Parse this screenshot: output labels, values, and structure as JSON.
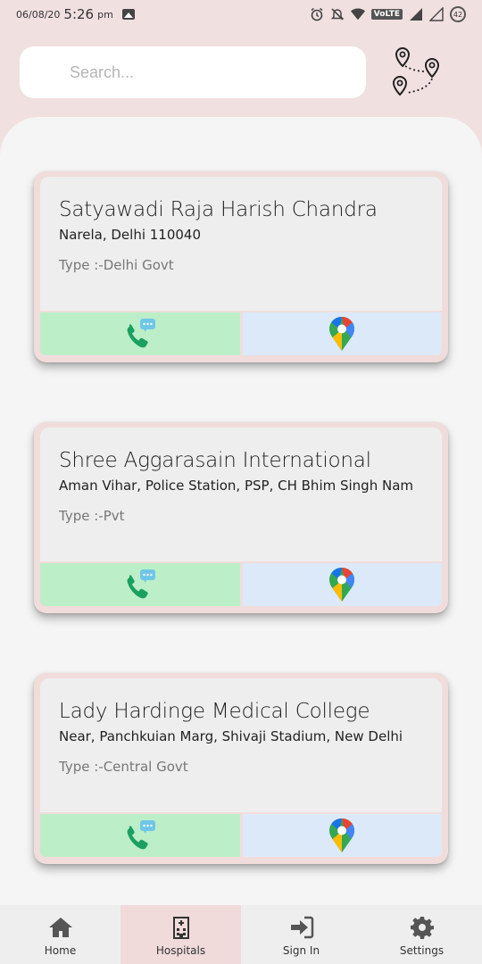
{
  "status_bar": {
    "date": "06/08/20",
    "time": "5:26",
    "ampm": "pm",
    "volte": "VoLTE",
    "battery": "42"
  },
  "search": {
    "placeholder": "Search..."
  },
  "hospitals": [
    {
      "name": "Satyawadi Raja Harish Chandra",
      "address": "Narela, Delhi 110040",
      "type": "Type :-Delhi Govt"
    },
    {
      "name": "Shree Aggarasain International",
      "address": "Aman Vihar, Police Station, PSP, CH Bhim Singh Nam",
      "type": "Type :-Pvt"
    },
    {
      "name": "Lady Hardinge Medical College",
      "address": "Near, Panchkuian Marg, Shivaji Stadium, New Delhi",
      "type": "Type :-Central Govt"
    }
  ],
  "nav": {
    "home": "Home",
    "hospitals": "Hospitals",
    "sign_in": "Sign In",
    "settings": "Settings",
    "active": "hospitals"
  },
  "colors": {
    "background": "#f1e0e0",
    "call_button": "#bcefc8",
    "map_button": "#dce9f9",
    "call_icon": "#1aa061"
  },
  "icons": {
    "call": "phone-chat-icon",
    "map": "google-maps-pin-icon",
    "route": "route-map-icon",
    "home": "home-icon",
    "hospitals": "hospital-building-icon",
    "sign_in": "sign-in-icon",
    "settings": "gear-icon"
  }
}
